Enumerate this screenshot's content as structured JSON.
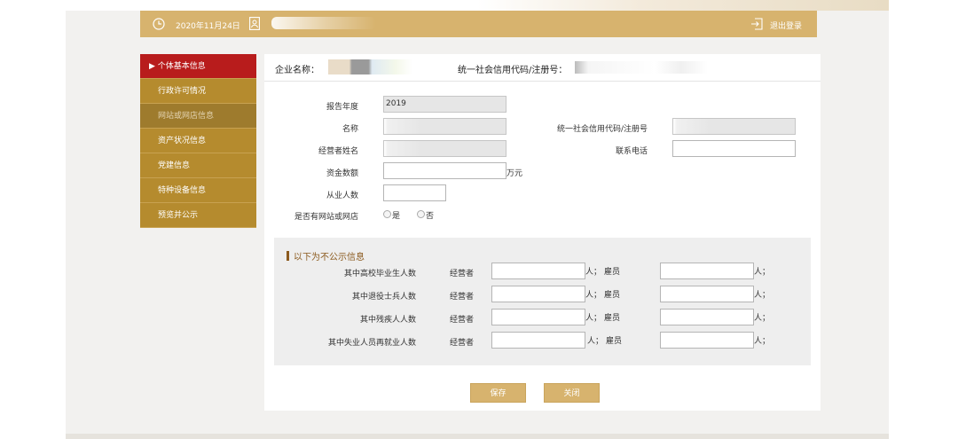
{
  "header": {
    "date": "2020年11月24日",
    "logout_label": "退出登录"
  },
  "sidebar": {
    "items": [
      {
        "label": "▶ 个体基本信息"
      },
      {
        "label": "行政许可情况"
      },
      {
        "label": "网站或网店信息"
      },
      {
        "label": "资产状况信息"
      },
      {
        "label": "党建信息"
      },
      {
        "label": "特种设备信息"
      },
      {
        "label": "预览并公示"
      }
    ]
  },
  "enterprise": {
    "name_label": "企业名称：",
    "code_label": "统一社会信用代码/注册号："
  },
  "form": {
    "report_year_label": "报告年度",
    "report_year_value": "2019",
    "name_label": "名称",
    "credit_code_label": "统一社会信用代码/注册号",
    "operator_label": "经营者姓名",
    "phone_label": "联系电话",
    "capital_label": "资金数额",
    "capital_unit": "万元",
    "staff_label": "从业人数",
    "website_label": "是否有网站或网店",
    "yes_label": "是",
    "no_label": "否"
  },
  "hidden": {
    "title": "以下为不公示信息",
    "rows": [
      {
        "label": "其中高校毕业生人数",
        "operator": "经营者",
        "unit1": "人；",
        "employee": "雇员",
        "unit2": "人；"
      },
      {
        "label": "其中退役士兵人数",
        "operator": "经营者",
        "unit1": "人；",
        "employee": "雇员",
        "unit2": "人；"
      },
      {
        "label": "其中残疾人人数",
        "operator": "经营者",
        "unit1": "人；",
        "employee": "雇员",
        "unit2": "人；"
      },
      {
        "label": "其中失业人员再就业人数",
        "operator": "经营者",
        "unit1": "人；",
        "employee": "雇员",
        "unit2": "人；"
      }
    ]
  },
  "buttons": {
    "save": "保存",
    "close": "关闭"
  },
  "icons": [
    "clock-icon",
    "user-card-icon",
    "logout-icon"
  ],
  "colors": {
    "header_bar": "#d7b36e",
    "sidebar_item": "#b58b2e",
    "sidebar_active": "#b81c1c",
    "section_title": "#8b5a1e"
  }
}
